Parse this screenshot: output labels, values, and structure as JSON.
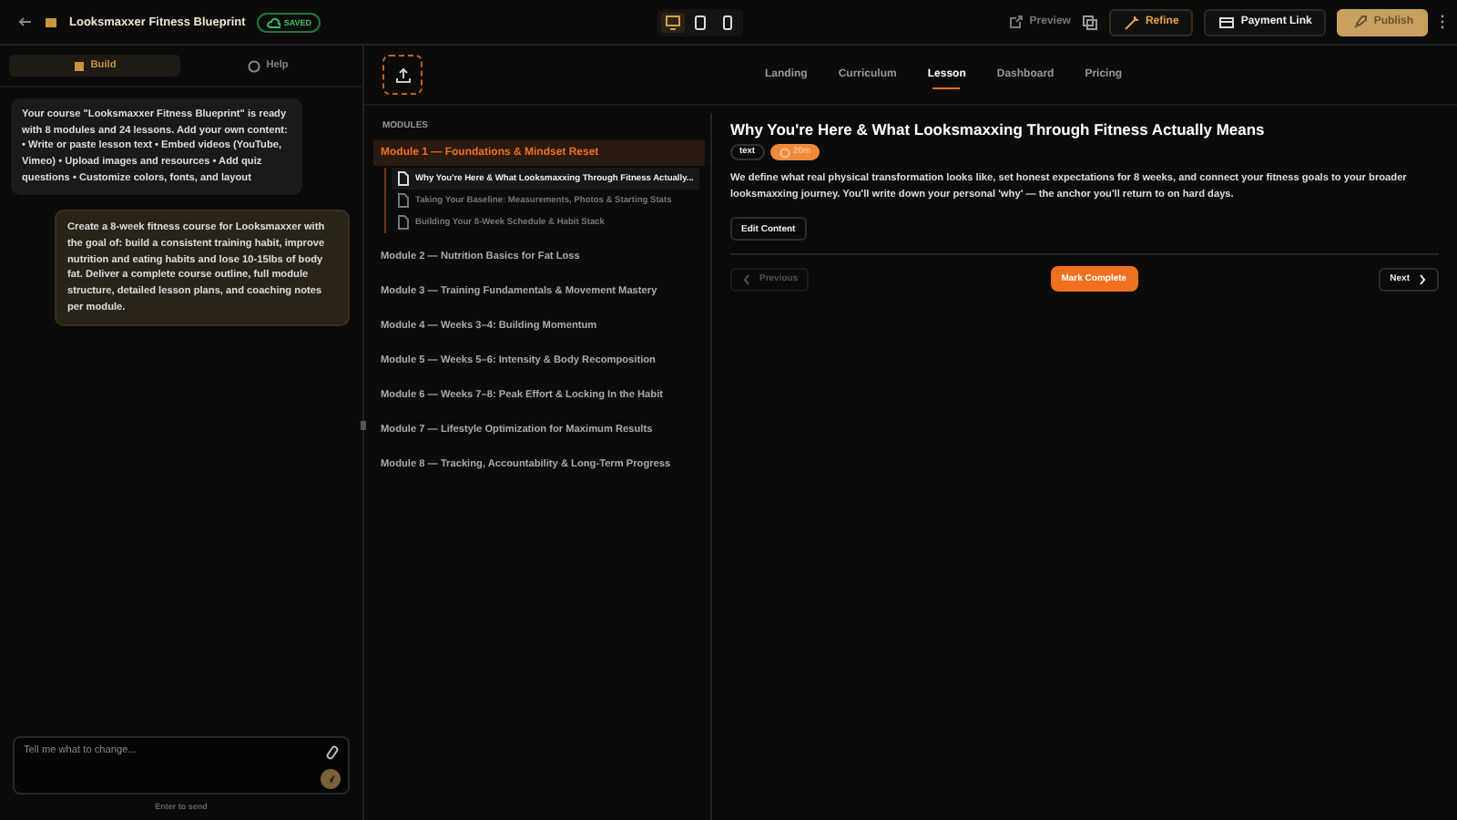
{
  "header": {
    "title": "Looksmaxxer Fitness Blueprint",
    "status": "SAVED",
    "devices": [
      {
        "kind": "desktop",
        "selected": true
      },
      {
        "kind": "tablet",
        "selected": false
      },
      {
        "kind": "phone",
        "selected": false
      }
    ],
    "preview": "Preview",
    "refine": "Refine",
    "payment_link": "Payment Link",
    "publish": "Publish"
  },
  "chat": {
    "tabs": [
      {
        "label": "Build",
        "selected": true
      },
      {
        "label": "Help",
        "selected": false
      }
    ],
    "messages": [
      {
        "kind": "assistant",
        "text": "Your course \"Looksmaxxer Fitness Blueprint\" is ready with 8 modules and 24 lessons. Add your own content: • Write or paste lesson text • Embed videos (YouTube, Vimeo) • Upload images and resources • Add quiz questions • Customize colors, fonts, and layout"
      },
      {
        "kind": "user",
        "text": "Create a 8-week fitness course for Looksmaxxer with the goal of: build a consistent training habit, improve nutrition and eating habits and lose 10-15lbs of body fat. Deliver a complete course outline, full module structure, detailed lesson plans, and coaching notes per module."
      }
    ],
    "input": {
      "placeholder": "Tell me what to change..."
    },
    "hint": "Enter to send"
  },
  "preview": {
    "tabs": [
      {
        "label": "Landing",
        "selected": false
      },
      {
        "label": "Curriculum",
        "selected": false
      },
      {
        "label": "Lesson",
        "selected": true
      },
      {
        "label": "Dashboard",
        "selected": false
      },
      {
        "label": "Pricing",
        "selected": false
      }
    ],
    "modules_heading": "MODULES",
    "modules": [
      {
        "title": "Module 1 — Foundations & Mindset Reset",
        "expanded": true,
        "children": [
          {
            "title": "Why You're Here & What Looksmaxxing Through Fitness Actually...",
            "selected": true
          },
          {
            "title": "Taking Your Baseline: Measurements, Photos & Starting Stats",
            "selected": false
          },
          {
            "title": "Building Your 8-Week Schedule & Habit Stack",
            "selected": false
          }
        ]
      },
      {
        "title": "Module 2 — Nutrition Basics for Fat Loss",
        "expanded": false
      },
      {
        "title": "Module 3 — Training Fundamentals & Movement Mastery",
        "expanded": false
      },
      {
        "title": "Module 4 — Weeks 3–4: Building Momentum",
        "expanded": false
      },
      {
        "title": "Module 5 — Weeks 5–6: Intensity & Body Recomposition",
        "expanded": false
      },
      {
        "title": "Module 6 — Weeks 7–8: Peak Effort & Locking In the Habit",
        "expanded": false
      },
      {
        "title": "Module 7 — Lifestyle Optimization for Maximum Results",
        "expanded": false
      },
      {
        "title": "Module 8 — Tracking, Accountability & Long-Term Progress",
        "expanded": false
      }
    ],
    "lesson": {
      "title": "Why You're Here & What Looksmaxxing Through Fitness Actually Means",
      "type": "text",
      "duration": "20m",
      "description": "We define what real physical transformation looks like, set honest expectations for 8 weeks, and connect your fitness goals to your broader looksmaxxing journey. You'll write down your personal 'why' — the anchor you'll return to on hard days.",
      "edit": "Edit Content",
      "previous": {
        "label": "Previous",
        "disabled": true
      },
      "complete": "Mark Complete",
      "next": {
        "label": "Next",
        "disabled": false
      }
    }
  }
}
